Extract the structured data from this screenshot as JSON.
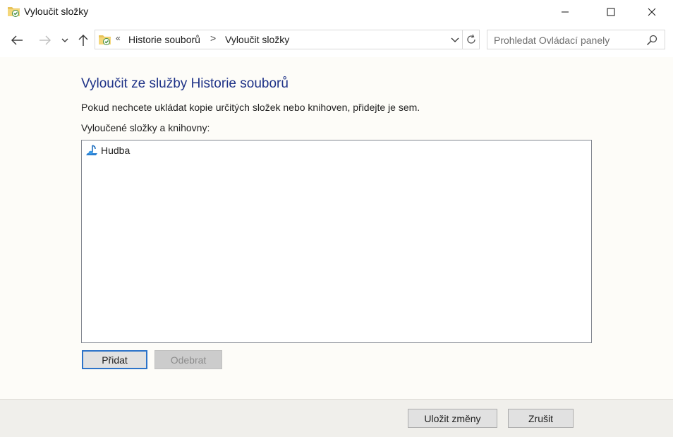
{
  "window": {
    "title": "Vyloučit složky",
    "icon": "file-history-folder-icon"
  },
  "nav": {
    "breadcrumb_overflow": "«",
    "breadcrumbs": [
      "Historie souborů",
      "Vyloučit složky"
    ],
    "breadcrumb_separator": ">",
    "search_placeholder": "Prohledat Ovládací panely"
  },
  "content": {
    "heading": "Vyloučit ze služby Historie souborů",
    "description": "Pokud nechcete ukládat kopie určitých složek nebo knihoven, přidejte je sem.",
    "list_label": "Vyloučené složky a knihovny:",
    "excluded_items": [
      {
        "label": "Hudba",
        "icon": "music-library-icon"
      }
    ],
    "add_button": "Přidat",
    "remove_button": "Odebrat"
  },
  "footer": {
    "save_button": "Uložit změny",
    "cancel_button": "Zrušit"
  },
  "colors": {
    "heading": "#1e3287",
    "accent_border": "#2c73c9",
    "background": "#fdfcf8",
    "footer": "#f0efeb"
  }
}
